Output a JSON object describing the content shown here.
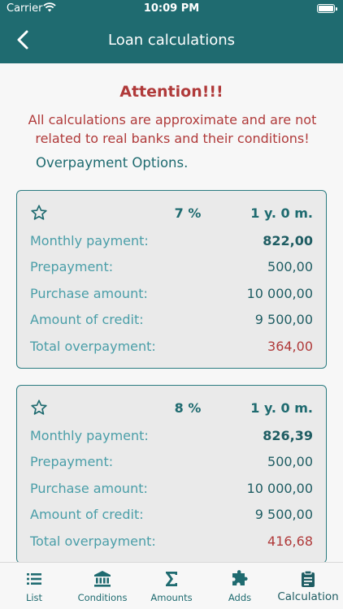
{
  "status": {
    "carrier": "Carrier",
    "time": "10:09 PM"
  },
  "nav": {
    "title": "Loan calculations"
  },
  "notice": {
    "attention": "Attention!!!",
    "text": "All calculations are approximate and are not related to real banks and their conditions!",
    "subtitle": "Overpayment Options."
  },
  "labels": {
    "monthly": "Monthly payment:",
    "prepayment": "Prepayment:",
    "purchase": "Purchase amount:",
    "credit": "Amount of credit:",
    "overpayment": "Total overpayment:"
  },
  "cards": [
    {
      "rate": "7 %",
      "term": "1 y. 0 m.",
      "monthly": "822,00",
      "prepayment": "500,00",
      "purchase": "10 000,00",
      "credit": "9 500,00",
      "overpayment": "364,00"
    },
    {
      "rate": "8 %",
      "term": "1 y. 0 m.",
      "monthly": "826,39",
      "prepayment": "500,00",
      "purchase": "10 000,00",
      "credit": "9 500,00",
      "overpayment": "416,68"
    }
  ],
  "tabs": [
    {
      "label": "List",
      "icon": "list-icon"
    },
    {
      "label": "Conditions",
      "icon": "bank-icon"
    },
    {
      "label": "Amounts",
      "icon": "sigma-icon"
    },
    {
      "label": "Adds",
      "icon": "puzzle-icon"
    },
    {
      "label": "Calculation",
      "icon": "clipboard-icon",
      "active": true
    }
  ],
  "colors": {
    "primary": "#1f6b70",
    "accent_text": "#4a9ea8",
    "warning": "#b03a3a",
    "card_bg": "#eaeaea"
  }
}
